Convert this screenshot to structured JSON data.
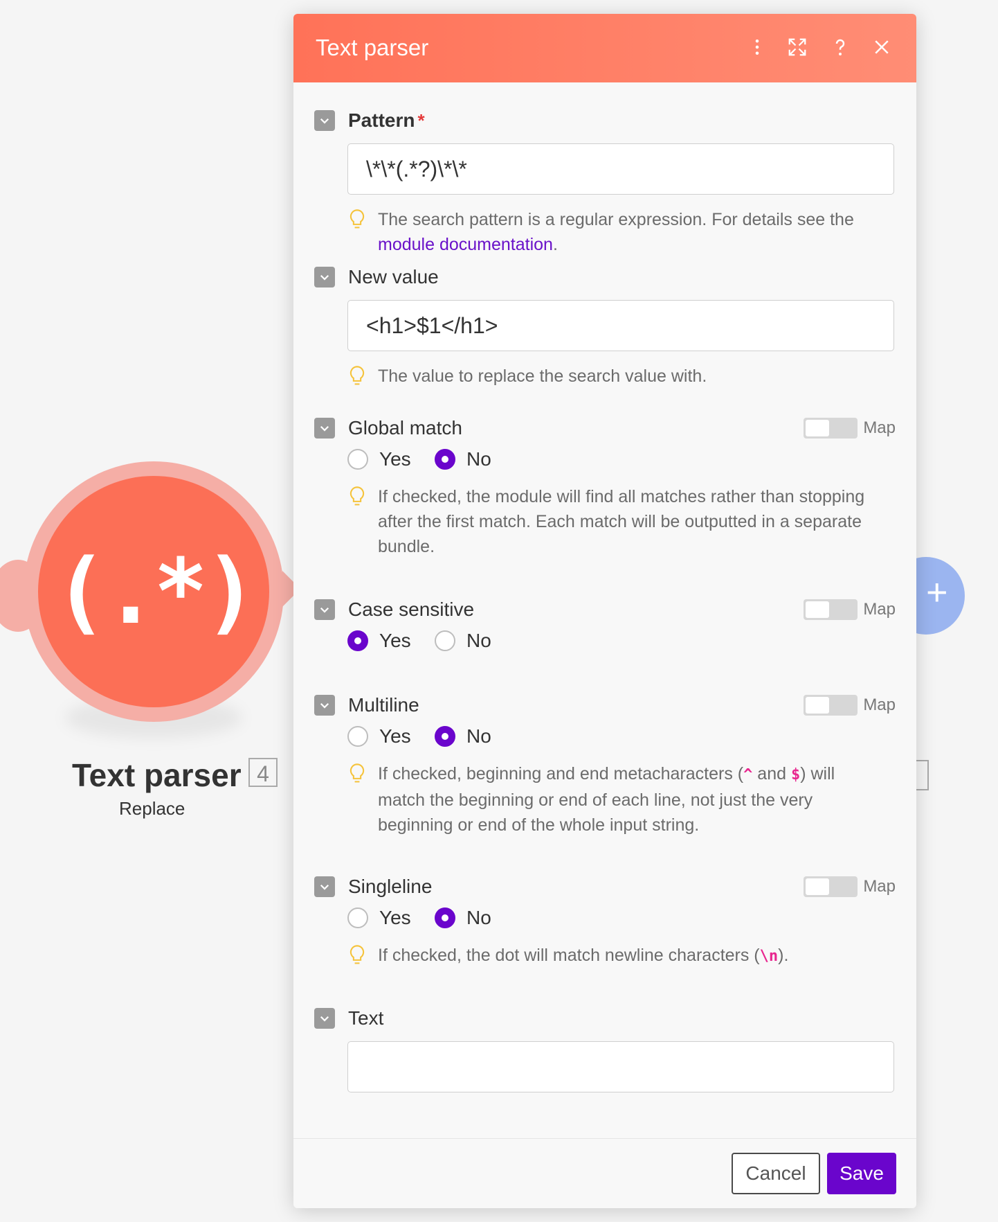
{
  "canvas": {
    "module": {
      "glyph": "(.*)",
      "title": "Text parser",
      "badge": "4",
      "subtitle": "Replace"
    },
    "next_module": {
      "plus": "+"
    }
  },
  "dialog": {
    "title": "Text parser",
    "header_icons": [
      "more-vertical-icon",
      "expand-icon",
      "help-icon",
      "close-icon"
    ],
    "fields": {
      "pattern": {
        "label": "Pattern",
        "required_mark": "*",
        "value": "\\*\\*(.*?)\\*\\*",
        "hint_text": "The search pattern is a regular expression. For details see the ",
        "hint_link": "module documentation",
        "hint_end": "."
      },
      "new_value": {
        "label": "New value",
        "value": "<h1>$1</h1>",
        "hint": "The value to replace the search value with."
      },
      "global_match": {
        "label": "Global match",
        "map_label": "Map",
        "yes": "Yes",
        "no": "No",
        "selected": "No",
        "hint": "If checked, the module will find all matches rather than stopping after the first match. Each match will be outputted in a separate bundle."
      },
      "case_sensitive": {
        "label": "Case sensitive",
        "map_label": "Map",
        "yes": "Yes",
        "no": "No",
        "selected": "Yes"
      },
      "multiline": {
        "label": "Multiline",
        "map_label": "Map",
        "yes": "Yes",
        "no": "No",
        "selected": "No",
        "hint_a": "If checked, beginning and end metacharacters (",
        "meta1": "^",
        "hint_b": " and ",
        "meta2": "$",
        "hint_c": ") will match the beginning or end of each line, not just the very beginning or end of the whole input string."
      },
      "singleline": {
        "label": "Singleline",
        "map_label": "Map",
        "yes": "Yes",
        "no": "No",
        "selected": "No",
        "hint_a": "If checked, the dot will match newline characters (",
        "meta": "\\n",
        "hint_b": ")."
      },
      "text": {
        "label": "Text",
        "value": ""
      }
    },
    "footer": {
      "cancel_label": "Cancel",
      "save_label": "Save"
    }
  },
  "colors": {
    "header_start": "#ff7258",
    "header_end": "#ff8d75",
    "accent": "#6a05cc",
    "link": "#6a12c9",
    "required": "#e53a3a",
    "module": "#fc6f56"
  }
}
